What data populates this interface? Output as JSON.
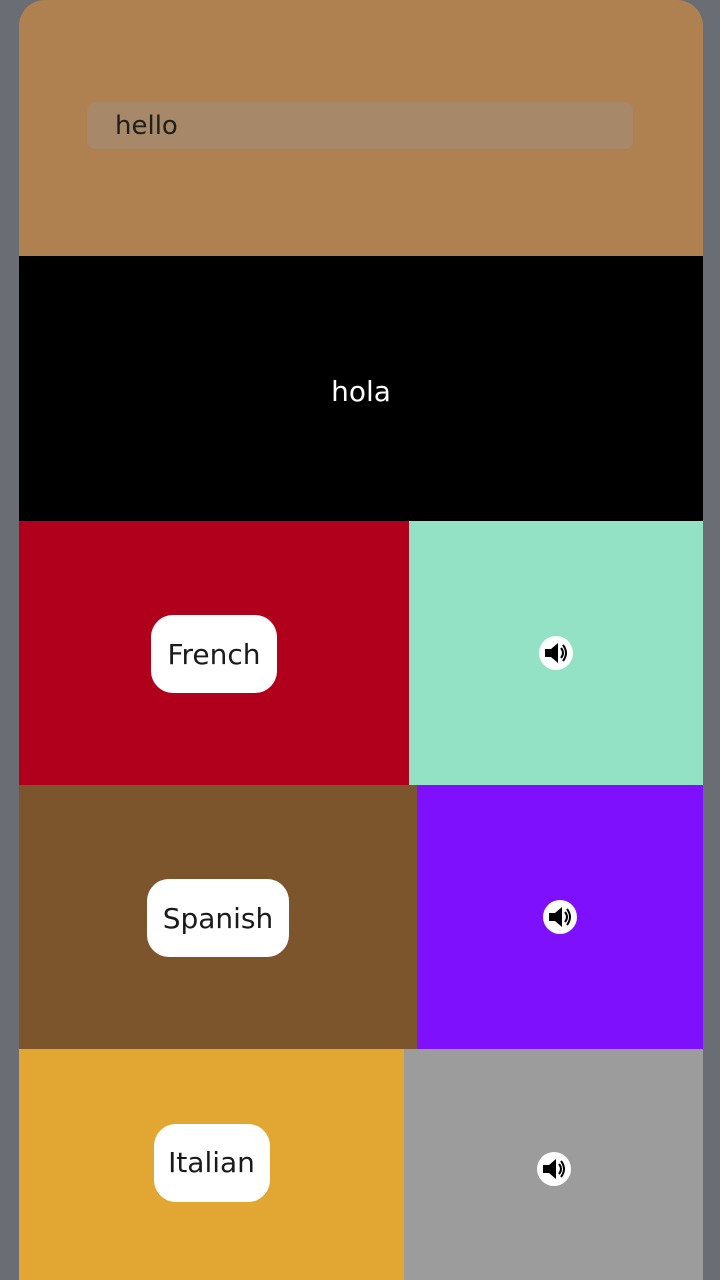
{
  "search": {
    "value": "hello"
  },
  "translation": {
    "text": "hola"
  },
  "languages": [
    {
      "label": "French",
      "color": "#b1001b",
      "speak_color": "#93e2c5",
      "speaker_icon": "speaker-icon"
    },
    {
      "label": "Spanish",
      "color": "#7d552c",
      "speak_color": "#7e10fd",
      "speaker_icon": "speaker-icon"
    },
    {
      "label": "Italian",
      "color": "#e2a633",
      "speak_color": "#9c9c9c",
      "speaker_icon": "speaker-icon"
    }
  ],
  "colors": {
    "header": "#b08150",
    "input": "#a78868",
    "output": "#000000",
    "frame": "#6a6d74"
  }
}
